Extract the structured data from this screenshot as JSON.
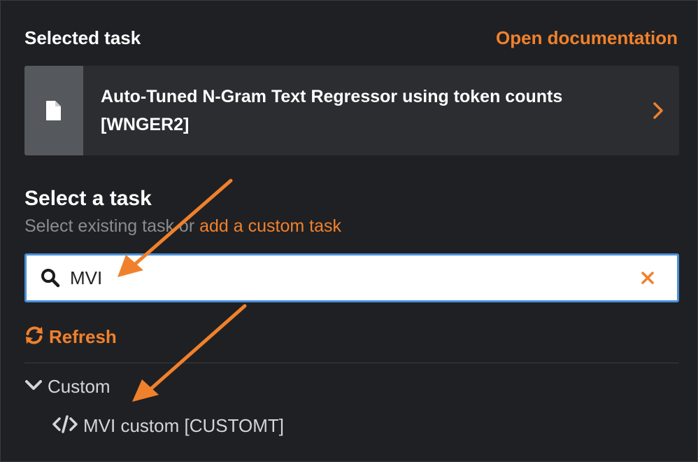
{
  "header": {
    "title": "Selected task",
    "doc_link": "Open documentation"
  },
  "selected_task": {
    "name_line1": "Auto-Tuned N-Gram Text Regressor using token counts",
    "name_line2": "[WNGER2]",
    "icon": "file-icon",
    "chevron_icon": "chevron-right-icon"
  },
  "select_section": {
    "title": "Select a task",
    "subtitle_prefix": "Select existing task or ",
    "subtitle_link": "add a custom task"
  },
  "search": {
    "value": "MVI",
    "icon": "search-icon",
    "clear_icon": "close-icon"
  },
  "refresh": {
    "label": "Refresh",
    "icon": "sync-icon"
  },
  "results": {
    "group_label": "Custom",
    "group_icon": "chevron-down-icon",
    "items": [
      {
        "label": "MVI custom [CUSTOMT]",
        "icon": "code-icon"
      }
    ]
  },
  "colors": {
    "accent": "#f0812c",
    "background": "#1f2023",
    "card": "#2b2d31",
    "focus_border": "#4a90d9",
    "annotation_arrow": "#f0812c"
  }
}
